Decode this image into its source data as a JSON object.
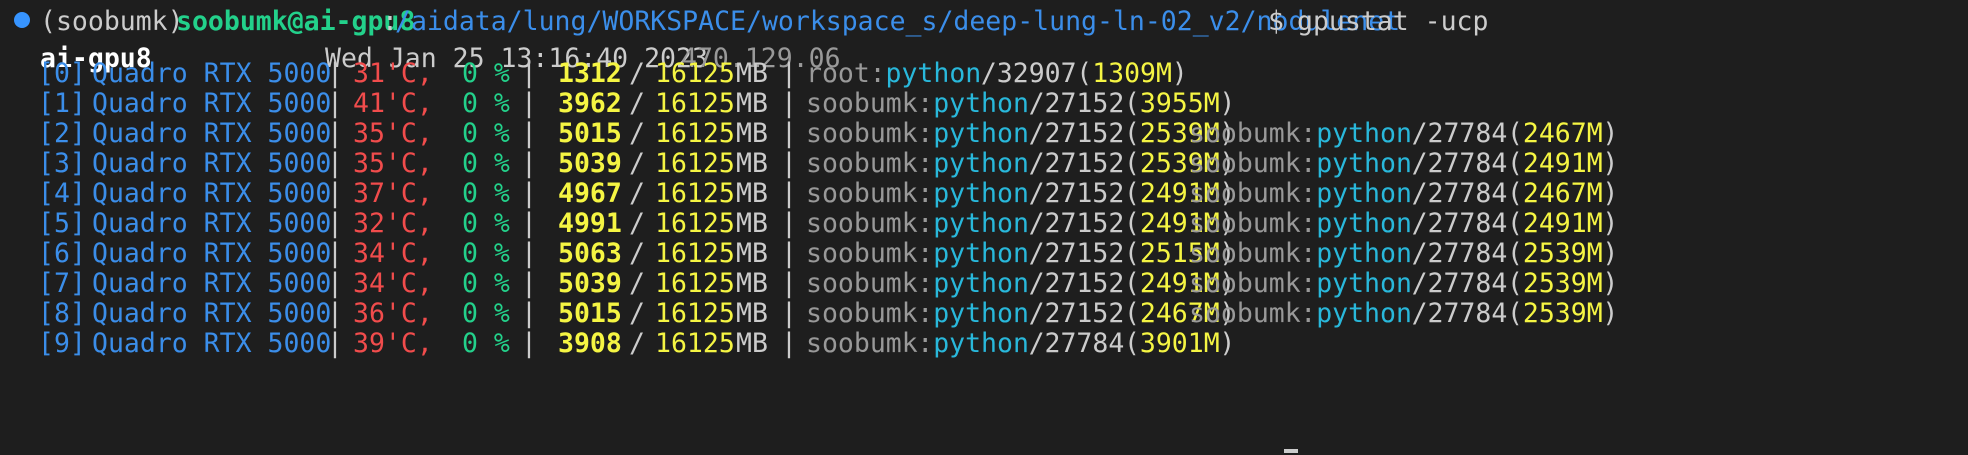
{
  "prompt": {
    "env": "(soobumk)",
    "userhost": "soobumk@ai-gpu8",
    "colon": ":",
    "path": "/aidata/lung/WORKSPACE/workspace_s/deep-lung-ln-02_v2/nodulenet",
    "dollar": "$",
    "command": "gpustat -ucp"
  },
  "header": {
    "host": "ai-gpu8",
    "datetime": "Wed Jan 25 13:16:40 2023",
    "driver": "470.129.06"
  },
  "gpus": [
    {
      "index": "[0]",
      "name": "Quadro RTX 5000",
      "temp": "31'C,",
      "util": "0 %",
      "mem_used": "1312",
      "mem_total": "16125",
      "mem_unit": "MB",
      "procs": [
        {
          "user": "root",
          "cmd": "python",
          "pid": "32907",
          "mem": "1309M"
        }
      ]
    },
    {
      "index": "[1]",
      "name": "Quadro RTX 5000",
      "temp": "41'C,",
      "util": "0 %",
      "mem_used": "3962",
      "mem_total": "16125",
      "mem_unit": "MB",
      "procs": [
        {
          "user": "soobumk",
          "cmd": "python",
          "pid": "27152",
          "mem": "3955M"
        }
      ]
    },
    {
      "index": "[2]",
      "name": "Quadro RTX 5000",
      "temp": "35'C,",
      "util": "0 %",
      "mem_used": "5015",
      "mem_total": "16125",
      "mem_unit": "MB",
      "procs": [
        {
          "user": "soobumk",
          "cmd": "python",
          "pid": "27152",
          "mem": "2539M"
        },
        {
          "user": "soobumk",
          "cmd": "python",
          "pid": "27784",
          "mem": "2467M"
        }
      ]
    },
    {
      "index": "[3]",
      "name": "Quadro RTX 5000",
      "temp": "35'C,",
      "util": "0 %",
      "mem_used": "5039",
      "mem_total": "16125",
      "mem_unit": "MB",
      "procs": [
        {
          "user": "soobumk",
          "cmd": "python",
          "pid": "27152",
          "mem": "2539M"
        },
        {
          "user": "soobumk",
          "cmd": "python",
          "pid": "27784",
          "mem": "2491M"
        }
      ]
    },
    {
      "index": "[4]",
      "name": "Quadro RTX 5000",
      "temp": "37'C,",
      "util": "0 %",
      "mem_used": "4967",
      "mem_total": "16125",
      "mem_unit": "MB",
      "procs": [
        {
          "user": "soobumk",
          "cmd": "python",
          "pid": "27152",
          "mem": "2491M"
        },
        {
          "user": "soobumk",
          "cmd": "python",
          "pid": "27784",
          "mem": "2467M"
        }
      ]
    },
    {
      "index": "[5]",
      "name": "Quadro RTX 5000",
      "temp": "32'C,",
      "util": "0 %",
      "mem_used": "4991",
      "mem_total": "16125",
      "mem_unit": "MB",
      "procs": [
        {
          "user": "soobumk",
          "cmd": "python",
          "pid": "27152",
          "mem": "2491M"
        },
        {
          "user": "soobumk",
          "cmd": "python",
          "pid": "27784",
          "mem": "2491M"
        }
      ]
    },
    {
      "index": "[6]",
      "name": "Quadro RTX 5000",
      "temp": "34'C,",
      "util": "0 %",
      "mem_used": "5063",
      "mem_total": "16125",
      "mem_unit": "MB",
      "procs": [
        {
          "user": "soobumk",
          "cmd": "python",
          "pid": "27152",
          "mem": "2515M"
        },
        {
          "user": "soobumk",
          "cmd": "python",
          "pid": "27784",
          "mem": "2539M"
        }
      ]
    },
    {
      "index": "[7]",
      "name": "Quadro RTX 5000",
      "temp": "34'C,",
      "util": "0 %",
      "mem_used": "5039",
      "mem_total": "16125",
      "mem_unit": "MB",
      "procs": [
        {
          "user": "soobumk",
          "cmd": "python",
          "pid": "27152",
          "mem": "2491M"
        },
        {
          "user": "soobumk",
          "cmd": "python",
          "pid": "27784",
          "mem": "2539M"
        }
      ]
    },
    {
      "index": "[8]",
      "name": "Quadro RTX 5000",
      "temp": "36'C,",
      "util": "0 %",
      "mem_used": "5015",
      "mem_total": "16125",
      "mem_unit": "MB",
      "procs": [
        {
          "user": "soobumk",
          "cmd": "python",
          "pid": "27152",
          "mem": "2467M"
        },
        {
          "user": "soobumk",
          "cmd": "python",
          "pid": "27784",
          "mem": "2539M"
        }
      ]
    },
    {
      "index": "[9]",
      "name": "Quadro RTX 5000",
      "temp": "39'C,",
      "util": "0 %",
      "mem_used": "3908",
      "mem_total": "16125",
      "mem_unit": "MB",
      "procs": [
        {
          "user": "soobumk",
          "cmd": "python",
          "pid": "27784",
          "mem": "3901M"
        }
      ]
    }
  ],
  "colors": {
    "background": "#1e1e1e",
    "prompt_marker": "#3794ff",
    "userhost": "#23d18b",
    "path": "#3b8eea",
    "temp": "#f14c4c",
    "util": "#23d18b",
    "mem_used": "#f5f543",
    "proc_cmd": "#29b8db"
  },
  "icons": {
    "prompt_marker": "circle-dot-icon"
  }
}
